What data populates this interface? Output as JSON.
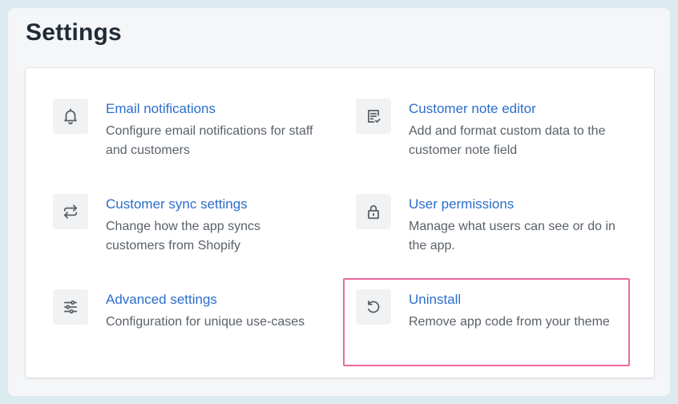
{
  "page": {
    "title": "Settings"
  },
  "settings": {
    "items": [
      {
        "title": "Email notifications",
        "description": "Configure email notifications for staff and customers",
        "icon": "bell-icon"
      },
      {
        "title": "Customer note editor",
        "description": "Add and format custom data to the customer note field",
        "icon": "note-edit-icon"
      },
      {
        "title": "Customer sync settings",
        "description": "Change how the app syncs customers from Shopify",
        "icon": "sync-icon"
      },
      {
        "title": "User permissions",
        "description": "Manage what users can see or do in the app.",
        "icon": "lock-icon"
      },
      {
        "title": "Advanced settings",
        "description": "Configuration for unique use-cases",
        "icon": "sliders-icon"
      },
      {
        "title": "Uninstall",
        "description": "Remove app code from your theme",
        "icon": "undo-icon"
      }
    ]
  },
  "colors": {
    "link": "#2c6ecb",
    "highlight_border": "#e96aa0",
    "icon": "#5c5f62"
  }
}
